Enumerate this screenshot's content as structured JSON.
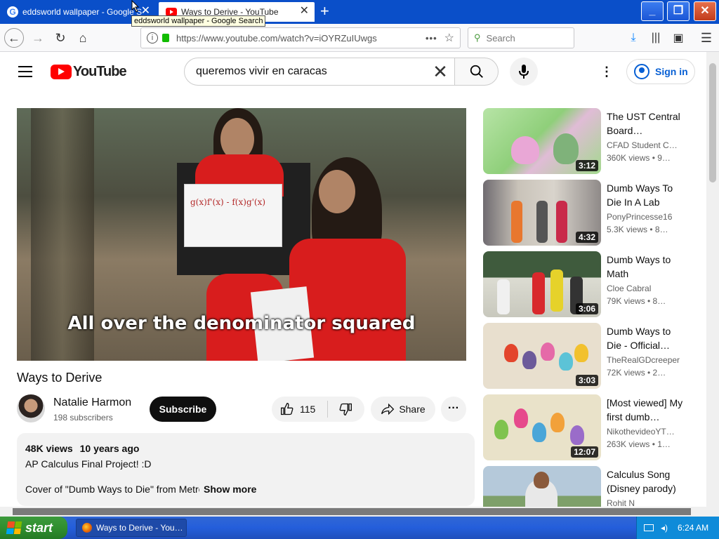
{
  "browser": {
    "tabs": [
      {
        "title": "eddsworld wallpaper - Google Search",
        "active": false
      },
      {
        "title": "Ways to Derive - YouTube",
        "active": true
      }
    ],
    "tooltip": "eddsworld wallpaper - Google Search",
    "url": "https://www.youtube.com/watch?v=iOYRZuIUwgs",
    "search_placeholder": "Search"
  },
  "youtube": {
    "logo_text": "YouTube",
    "search_query": "queremos vivir en caracas",
    "signin_label": "Sign in"
  },
  "video": {
    "caption": "All over the denominator squared",
    "paper_text": "g(x)f'(x) - f(x)g'(x)",
    "title": "Ways to Derive",
    "channel": "Natalie Harmon",
    "subscribers": "198 subscribers",
    "subscribe_label": "Subscribe",
    "likes": "115",
    "share_label": "Share",
    "views": "48K views",
    "age": "10 years ago",
    "desc_line1": "AP Calculus Final Project! :D",
    "desc_line2": "Cover of \"Dumb Ways to Die\" from Metro",
    "show_more": "Show more"
  },
  "recommendations": [
    {
      "title": "The UST Central Board…",
      "channel": "CFAD Student C…",
      "meta": "360K views • 9…",
      "duration": "3:12"
    },
    {
      "title": "Dumb Ways To Die In A Lab",
      "channel": "PonyPrincesse16",
      "meta": "5.3K views • 8…",
      "duration": "4:32"
    },
    {
      "title": "Dumb Ways to Math",
      "channel": "Cloe Cabral",
      "meta": "79K views • 8…",
      "duration": "3:06"
    },
    {
      "title": "Dumb Ways to Die - Official…",
      "channel": "TheRealGDcreeper",
      "meta": "72K views • 2…",
      "duration": "3:03"
    },
    {
      "title": "[Most viewed] My first dumb…",
      "channel": "NikothevideoYT…",
      "meta": "263K views • 1…",
      "duration": "12:07"
    },
    {
      "title": "Calculus Song (Disney parody)",
      "channel": "Rohit N",
      "meta": "",
      "duration": ""
    }
  ],
  "taskbar": {
    "start_label": "start",
    "task_label": "Ways to Derive - You…",
    "clock": "6:24 AM"
  },
  "colors": {
    "yt_red": "#ff0000",
    "link_blue": "#065fd4",
    "xp_blue": "#245edb",
    "xp_green": "#308f2f"
  }
}
